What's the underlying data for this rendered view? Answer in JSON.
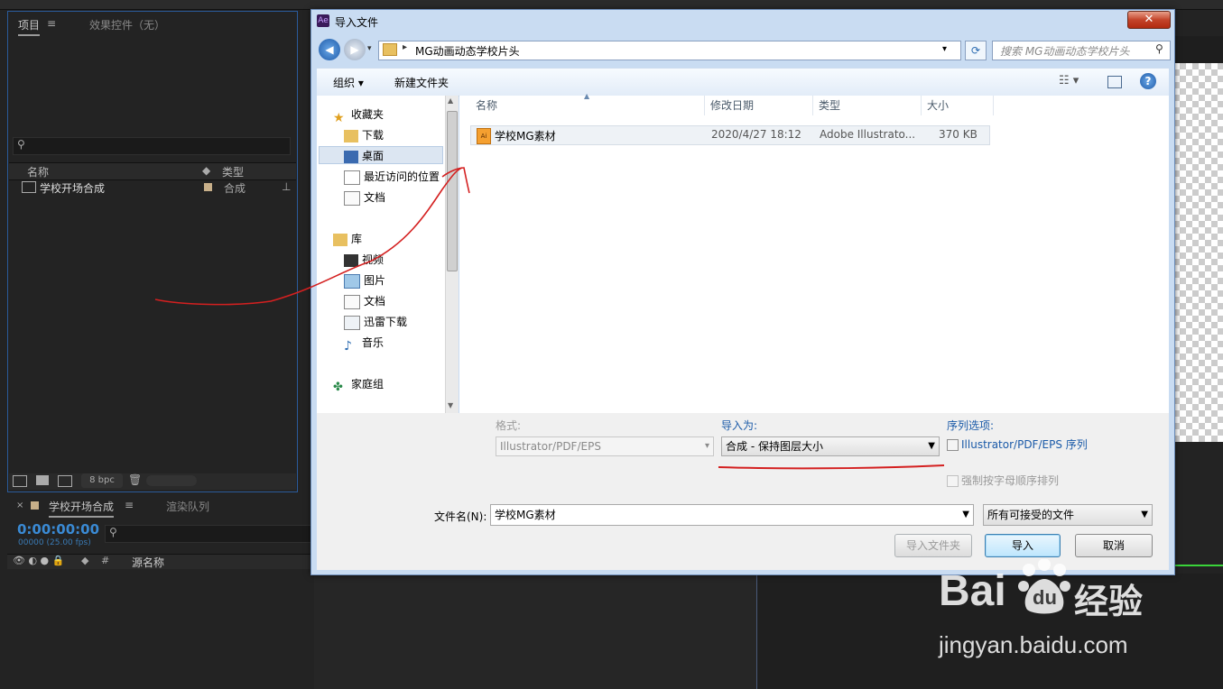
{
  "ae": {
    "project_tab": "项目",
    "effects_tab": "效果控件（无）",
    "col_name": "名称",
    "col_type": "类型",
    "item_name": "学校开场合成",
    "item_type": "合成",
    "bpc": "8 bpc",
    "timeline_tab": "学校开场合成",
    "render_tab": "渲染队列",
    "timecode": "0:00:00:00",
    "fps": "00000 (25.00 fps)",
    "source_name": "源名称"
  },
  "dialog": {
    "title": "导入文件",
    "close_label": "✕",
    "address_path": "MG动画动态学校片头",
    "search_placeholder": "搜索 MG动画动态学校片头",
    "cmd_organize": "组织 ▾",
    "cmd_new_folder": "新建文件夹",
    "nav": {
      "favorites": "收藏夹",
      "downloads": "下载",
      "desktop": "桌面",
      "recent": "最近访问的位置",
      "docs1": "文档",
      "library": "库",
      "video": "视频",
      "pictures": "图片",
      "docs2": "文档",
      "thunder": "迅雷下载",
      "music": "音乐",
      "homegroup": "家庭组"
    },
    "columns": {
      "name": "名称",
      "date": "修改日期",
      "type": "类型",
      "size": "大小"
    },
    "file": {
      "name": "学校MG素材",
      "date": "2020/4/27 18:12",
      "type": "Adobe Illustrato...",
      "size": "370 KB"
    },
    "format_label": "格式:",
    "format_value": "Illustrator/PDF/EPS",
    "import_as_label": "导入为:",
    "import_as_value": "合成 - 保持图层大小",
    "sequence_label": "序列选项:",
    "sequence_checkbox": "Illustrator/PDF/EPS 序列",
    "alpha_checkbox": "强制按字母顺序排列",
    "filename_label": "文件名(N):",
    "filename_value": "学校MG素材",
    "filetype_value": "所有可接受的文件",
    "btn_import_folder": "导入文件夹",
    "btn_import": "导入",
    "btn_cancel": "取消"
  },
  "watermark": {
    "brand": "Bai",
    "brand2": "du",
    "cn": "经验",
    "url": "jingyan.baidu.com"
  },
  "colors": {
    "accent_blue": "#2a5a9a",
    "annotation_red": "#d42020",
    "timecode_blue": "#3a8ad4"
  }
}
